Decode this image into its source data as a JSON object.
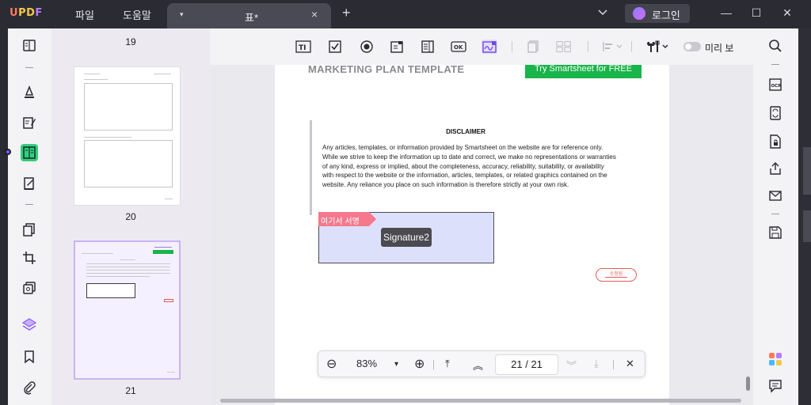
{
  "app": {
    "logo": {
      "u": "U",
      "pd": "PD",
      "f": "F"
    },
    "menu": {
      "file": "파일",
      "help": "도움말"
    },
    "tab": {
      "title": "표*",
      "close": "×",
      "dropdown": "▾"
    },
    "new_tab": "+",
    "login_label": "로그인",
    "window": {
      "minimize": "—",
      "maximize": "☐",
      "close": "✕"
    }
  },
  "toolbar": {
    "text_field_label": "TI",
    "preview_label": "미리 보"
  },
  "thumbnails": {
    "page_labels": [
      "19",
      "20",
      "21"
    ]
  },
  "document": {
    "title": "MARKETING PLAN TEMPLATE",
    "try_button": "Try Smartsheet for FREE",
    "disclaimer_heading": "DISCLAIMER",
    "disclaimer_text": "Any articles, templates, or information provided by Smartsheet on the website are for reference only. While we strive to keep the information up to date and correct, we make no representations or warranties of any kind, express or implied, about the completeness, accuracy, reliability, suitability, or availability with respect to the website or the information, articles, templates, or related graphics contained on the website. Any reliance you place on such information is therefore strictly at your own risk.",
    "sign_here": "여기서 서명",
    "signature_field": "Signature2",
    "stamp_text": "수정됨"
  },
  "zoombar": {
    "zoom_out": "⊖",
    "zoom_level": "83%",
    "zoom_dropdown": "▾",
    "zoom_in": "⊕",
    "first_page": "⤒",
    "prev_page": "︽",
    "current_page": "21",
    "page_separator": "/",
    "total_pages": "21",
    "next_page": "︾",
    "last_page": "⤓",
    "close": "✕"
  },
  "colors": {
    "accent_purple": "#7b5cff",
    "active_green": "#2fd07a",
    "try_button_green": "#19b44a",
    "sign_flag": "#f5788c",
    "signature_fill": "#dde0fb"
  }
}
